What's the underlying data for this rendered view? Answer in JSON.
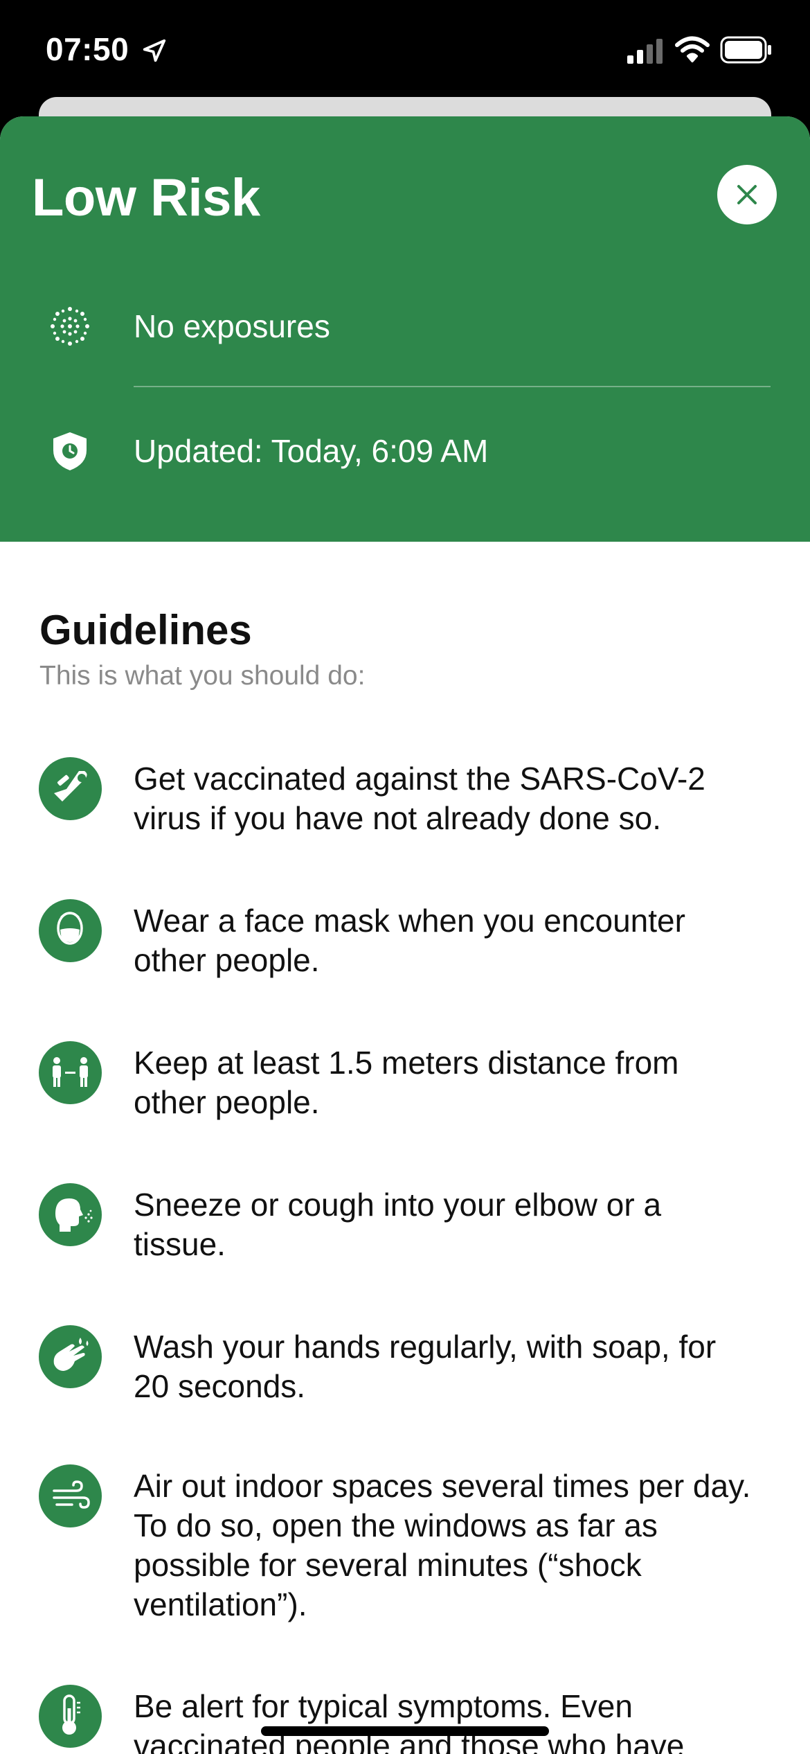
{
  "status_bar": {
    "time": "07:50"
  },
  "risk": {
    "title": "Low Risk",
    "exposures": "No exposures",
    "updated": "Updated: Today, 6:09 AM"
  },
  "guidelines": {
    "title": "Guidelines",
    "subtitle": "This is what you should do:",
    "items": [
      {
        "icon": "vaccine-arm-icon",
        "text": "Get vaccinated against the SARS-CoV-2 virus if you have not already done so."
      },
      {
        "icon": "face-mask-icon",
        "text": "Wear a face mask when you encounter other people."
      },
      {
        "icon": "distance-icon",
        "text": "Keep at least 1.5 meters distance from other people."
      },
      {
        "icon": "sneeze-icon",
        "text": "Sneeze or cough into your elbow or a tissue."
      },
      {
        "icon": "wash-hands-icon",
        "text": "Wash your hands regularly, with soap, for 20 seconds."
      },
      {
        "icon": "ventilation-icon",
        "text": "Air out indoor spaces several times per day. To do so, open the windows as far as possible for several minutes (“shock ventilation”)."
      },
      {
        "icon": "thermometer-icon",
        "text": "Be alert for typical symptoms. Even vaccinated people and those who have"
      }
    ]
  },
  "colors": {
    "accent": "#2e874b",
    "text": "#111111",
    "muted": "#8a8a8a"
  }
}
